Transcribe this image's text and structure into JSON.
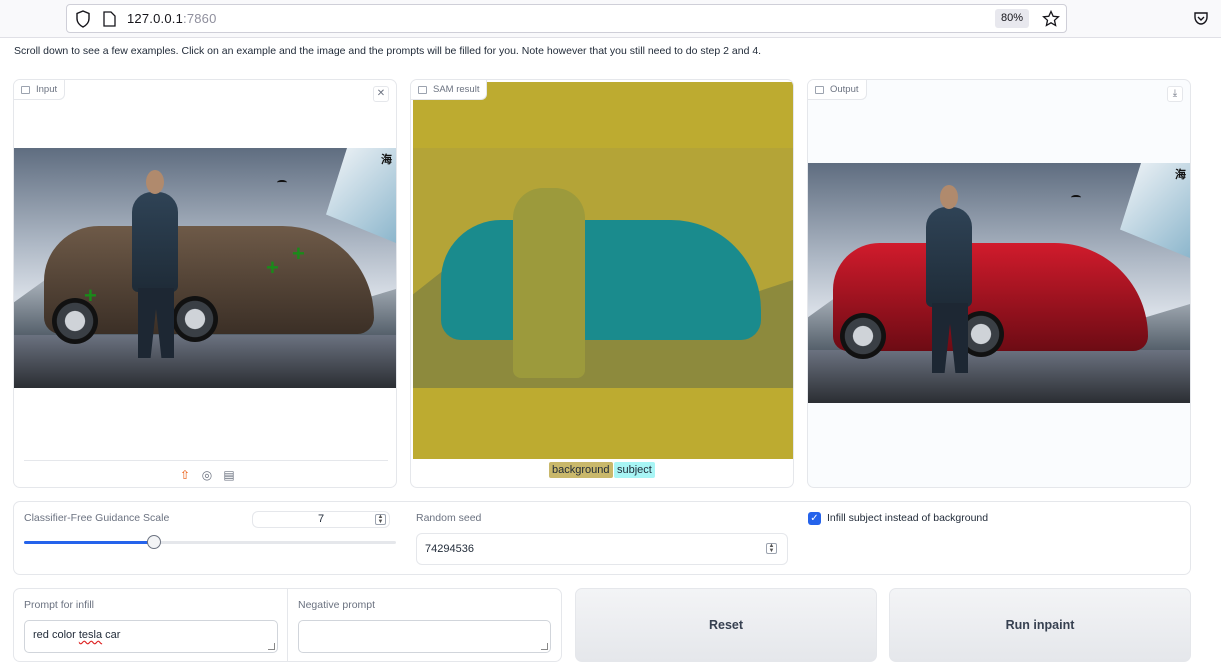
{
  "browser": {
    "url_host": "127.0.0.1",
    "url_port": ":7860",
    "zoom": "80%"
  },
  "intro_text": "Scroll down to see a few examples. Click on an example and the image and the prompts will be filled for you. Note however that you still need to do step 2 and 4.",
  "panels": {
    "input_label": "Input",
    "sam_label": "SAM result",
    "output_label": "Output",
    "clear_icon": "close-icon",
    "download_icon": "download-icon"
  },
  "image_sign_text": "海",
  "sam_legend": {
    "background": "background",
    "subject": "subject",
    "background_color": "#c9b86b",
    "subject_color": "#a8f5f5"
  },
  "input_tools": [
    "upload-icon",
    "webcam-icon",
    "clipboard-icon"
  ],
  "controls": {
    "cfg_label": "Classifier-Free Guidance Scale",
    "cfg_value": "7",
    "cfg_fraction": 0.35,
    "seed_label": "Random seed",
    "seed_value": "74294536",
    "infill_subject_label": "Infill subject instead of background",
    "infill_subject_checked": true
  },
  "prompts": {
    "infill_label": "Prompt for infill",
    "infill_value_pre": "red color ",
    "infill_value_misspelled": "tesla",
    "infill_value_post": " car",
    "negative_label": "Negative prompt",
    "negative_value": ""
  },
  "buttons": {
    "reset": "Reset",
    "run": "Run inpaint"
  },
  "colors": {
    "accent": "#2563eb",
    "point_marker": "#1a8a1a",
    "output_car": "#b3121f"
  }
}
